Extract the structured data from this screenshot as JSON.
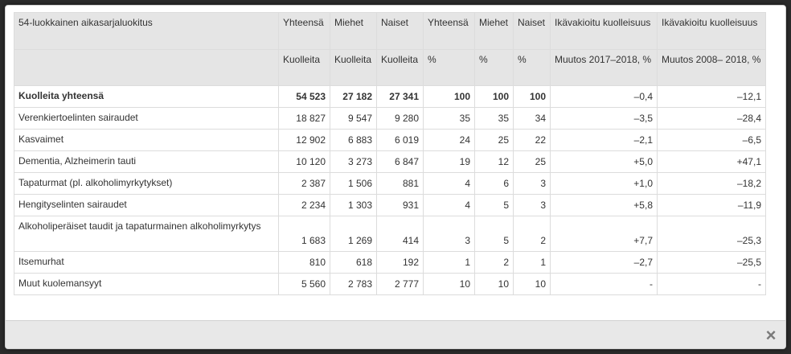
{
  "table": {
    "header_row1": [
      "54-luokkainen aikasarjaluokitus",
      "Yhteensä",
      "Miehet",
      "Naiset",
      "Yhteensä",
      "Miehet",
      "Naiset",
      "Ikävakioitu kuolleisuus",
      "Ikävakioitu kuolleisuus"
    ],
    "header_row2": [
      "",
      "Kuolleita",
      "Kuolleita",
      "Kuolleita",
      "%",
      "%",
      "%",
      "Muutos 2017–2018, %",
      "Muutos 2008– 2018, %"
    ],
    "rows": [
      [
        "Kuolleita yhteensä",
        "54 523",
        "27 182",
        "27 341",
        "100",
        "100",
        "100",
        "–0,4",
        "–12,1"
      ],
      [
        "Verenkiertoelinten sairaudet",
        "18 827",
        "9 547",
        "9 280",
        "35",
        "35",
        "34",
        "–3,5",
        "–28,4"
      ],
      [
        "Kasvaimet",
        "12 902",
        "6 883",
        "6 019",
        "24",
        "25",
        "22",
        "–2,1",
        "–6,5"
      ],
      [
        "Dementia, Alzheimerin tauti",
        "10 120",
        "3 273",
        "6 847",
        "19",
        "12",
        "25",
        "+5,0",
        "+47,1"
      ],
      [
        "Tapaturmat (pl. alkoholimyrkytykset)",
        "2 387",
        "1 506",
        "881",
        "4",
        "6",
        "3",
        "+1,0",
        "–18,2"
      ],
      [
        "Hengityselinten sairaudet",
        "2 234",
        "1 303",
        "931",
        "4",
        "5",
        "3",
        "+5,8",
        "–11,9"
      ],
      [
        "Alkoholiperäiset taudit ja tapaturmainen alkoholimyrkytys",
        "1 683",
        "1 269",
        "414",
        "3",
        "5",
        "2",
        "+7,7",
        "–25,3"
      ],
      [
        "Itsemurhat",
        "810",
        "618",
        "192",
        "1",
        "2",
        "1",
        "–2,7",
        "–25,5"
      ],
      [
        "Muut kuolemansyyt",
        "5 560",
        "2 783",
        "2 777",
        "10",
        "10",
        "10",
        "-",
        "-"
      ]
    ]
  },
  "footer": {
    "close_icon": "×"
  }
}
